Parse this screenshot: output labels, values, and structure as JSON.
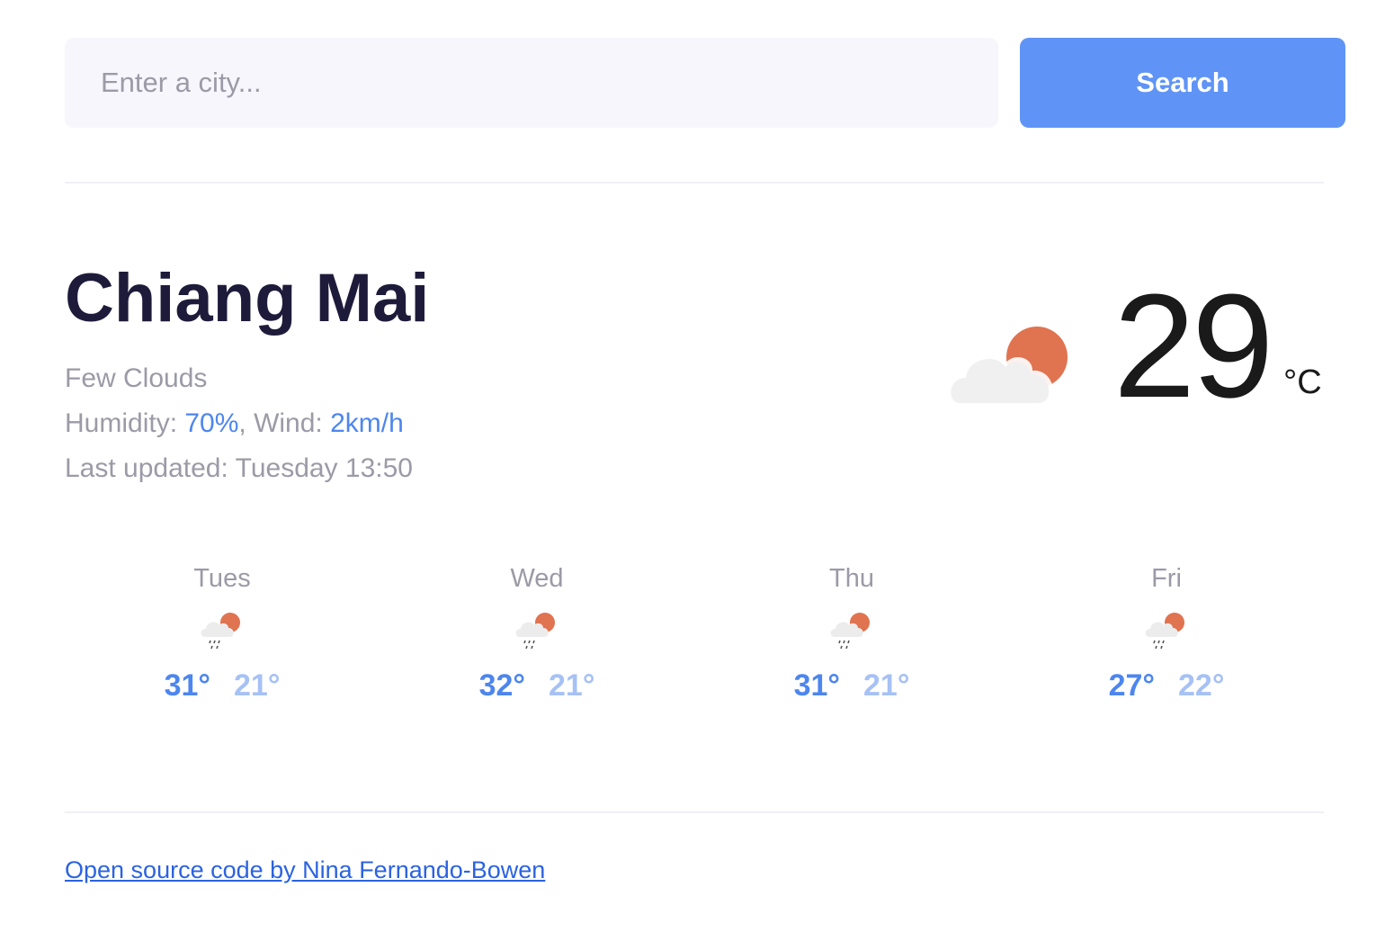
{
  "search": {
    "placeholder": "Enter a city...",
    "value": "",
    "button_label": "Search"
  },
  "current": {
    "city": "Chiang Mai",
    "description": "Few Clouds",
    "humidity_label": "Humidity: ",
    "humidity": "70%",
    "wind_label": ", Wind: ",
    "wind": "2km/h",
    "last_updated": "Last updated: Tuesday 13:50",
    "icon": "few-clouds-day-icon",
    "temperature": "29",
    "unit": "°C"
  },
  "forecast": [
    {
      "day": "Tues",
      "icon": "rain-day-icon",
      "max": "31°",
      "min": "21°"
    },
    {
      "day": "Wed",
      "icon": "rain-day-icon",
      "max": "32°",
      "min": "21°"
    },
    {
      "day": "Thu",
      "icon": "rain-day-icon",
      "max": "31°",
      "min": "21°"
    },
    {
      "day": "Fri",
      "icon": "rain-day-icon",
      "max": "27°",
      "min": "22°"
    }
  ],
  "footer": {
    "link_text": "Open source code by Nina Fernando-Bowen"
  },
  "colors": {
    "accent": "#5f94f6",
    "highlight": "#4d86ee",
    "min_temp": "#a6c1f5",
    "sun": "#e07350",
    "cloud": "#f1f1f1"
  }
}
